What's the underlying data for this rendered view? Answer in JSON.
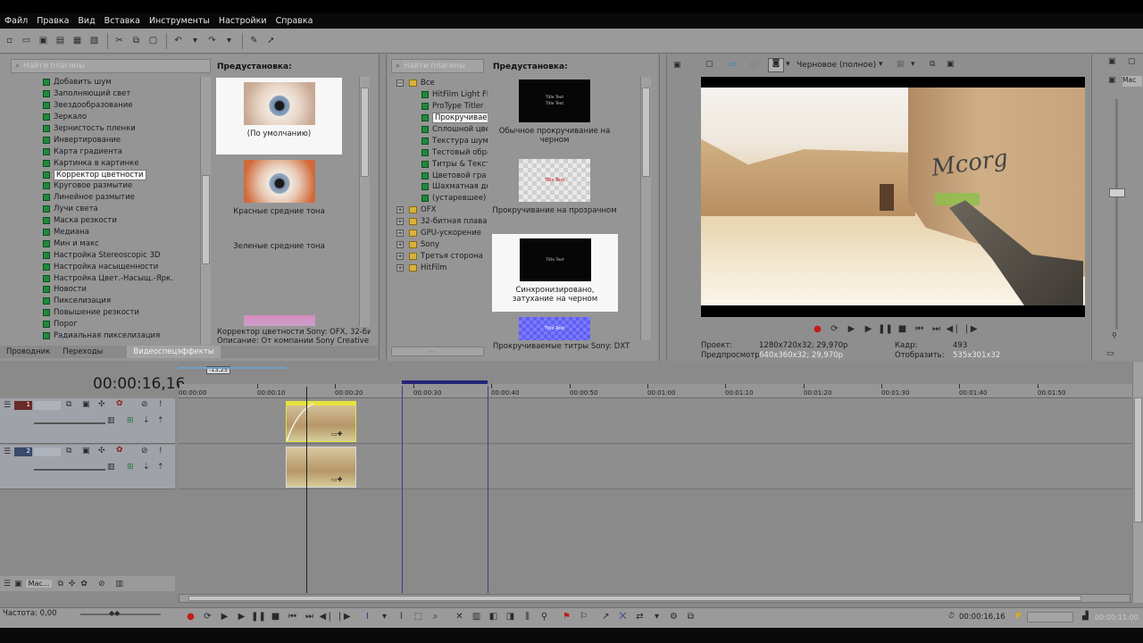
{
  "menu": [
    "Файл",
    "Правка",
    "Вид",
    "Вставка",
    "Инструменты",
    "Настройки",
    "Справка"
  ],
  "left_panel": {
    "search_placeholder": "Найти плагины",
    "effects": [
      "Добавить шум",
      "Заполняющий свет",
      "Звездообразование",
      "Зеркало",
      "Зернистость пленки",
      "Инвертирование",
      "Карта градиента",
      "Картинка в картинке",
      "Корректор цветности",
      "Круговое размытие",
      "Линейное размытие",
      "Лучи света",
      "Маска резкости",
      "Медиана",
      "Мин и макс",
      "Настройка Stereoscopic 3D",
      "Настройка насыщенности",
      "Настройка Цвет.-Насыщ.-Ярк.",
      "Новости",
      "Пикселизация",
      "Повышение резкости",
      "Порог",
      "Радиальная пикселизация"
    ],
    "selected_effect": "Корректор цветности",
    "preset_header": "Предустановка:",
    "presets": [
      "(По умолчанию)",
      "Красные средние тона",
      "Зеленые средние тона"
    ],
    "description_line1": "Корректор цветности Sony: OFX, 32-битн",
    "description_line2": "Описание: От компании Sony Creative Soft",
    "tabs": [
      "Проводник",
      "Переходы",
      "Видеоспецэффекты"
    ],
    "active_tab": "Видеоспецэффекты"
  },
  "mid_panel": {
    "search_placeholder": "Найти плагины",
    "root": "Все",
    "generators": [
      "HitFilm Light Fla",
      "ProType Titler",
      "Прокручиваем",
      "Сплошной цве",
      "Текстура шум",
      "Тестовый обра",
      "Титры & Текст",
      "Цветовой гра",
      "Шахматная до",
      "(устаревшее) "
    ],
    "selected_generator": "Прокручиваем",
    "groups": [
      "OFX",
      "32-битная плаваю",
      "GPU-ускорение",
      "Sony",
      "Третья сторона",
      "HitFilm"
    ],
    "preset_header": "Предустановка:",
    "presets": [
      "Обычное прокручивание на черном",
      "Прокручивание на прозрачном",
      "Синхронизировано, затухание на черном"
    ],
    "thumb_title": "Title Text",
    "thumb_red": "Title Text",
    "thumb_black_small": "Title Text",
    "description": "Прокручиваемые титры Sony: DXT"
  },
  "preview": {
    "quality": "Черновое (полное)",
    "project_label": "Проект:",
    "project_value": "1280x720x32; 29,970p",
    "preview_label": "Предпросмотр:",
    "preview_value": "640x360x32; 29,970p",
    "frame_label": "Кадр:",
    "frame_value": "493",
    "display_label": "Отобразить:",
    "display_value": "535x301x32",
    "graffiti": "Mcorg",
    "right_label": "Мас"
  },
  "timeline": {
    "timecode": "00:00:16,16",
    "cursor_marker": "-13,25",
    "ticks": [
      "00:00:00",
      "00:00:10",
      "00:00:20",
      "00:00:30",
      "00:00:40",
      "00:00:50",
      "00:01:00",
      "00:01:10",
      "00:01:20",
      "00:01:30",
      "00:01:40",
      "00:01:50"
    ],
    "tracks": [
      "1",
      "2"
    ],
    "master_label": "Мас...",
    "rate": "Частота: 0,00",
    "status_time": "00:00:16,16",
    "status_total": "00:00:11:00"
  },
  "colors": {
    "accent_loop": "#24247a",
    "clip_highlight": "#e6e33c",
    "fx_icon": "#1f8a3c",
    "folder": "#d9b23c",
    "record": "#c21a1a"
  },
  "icons": [
    "new-icon",
    "open-icon",
    "save-icon",
    "cut-icon",
    "copy-icon",
    "paste-icon",
    "undo-icon",
    "redo-icon",
    "record-icon",
    "play-icon",
    "pause-icon",
    "stop-icon",
    "loop-icon"
  ]
}
